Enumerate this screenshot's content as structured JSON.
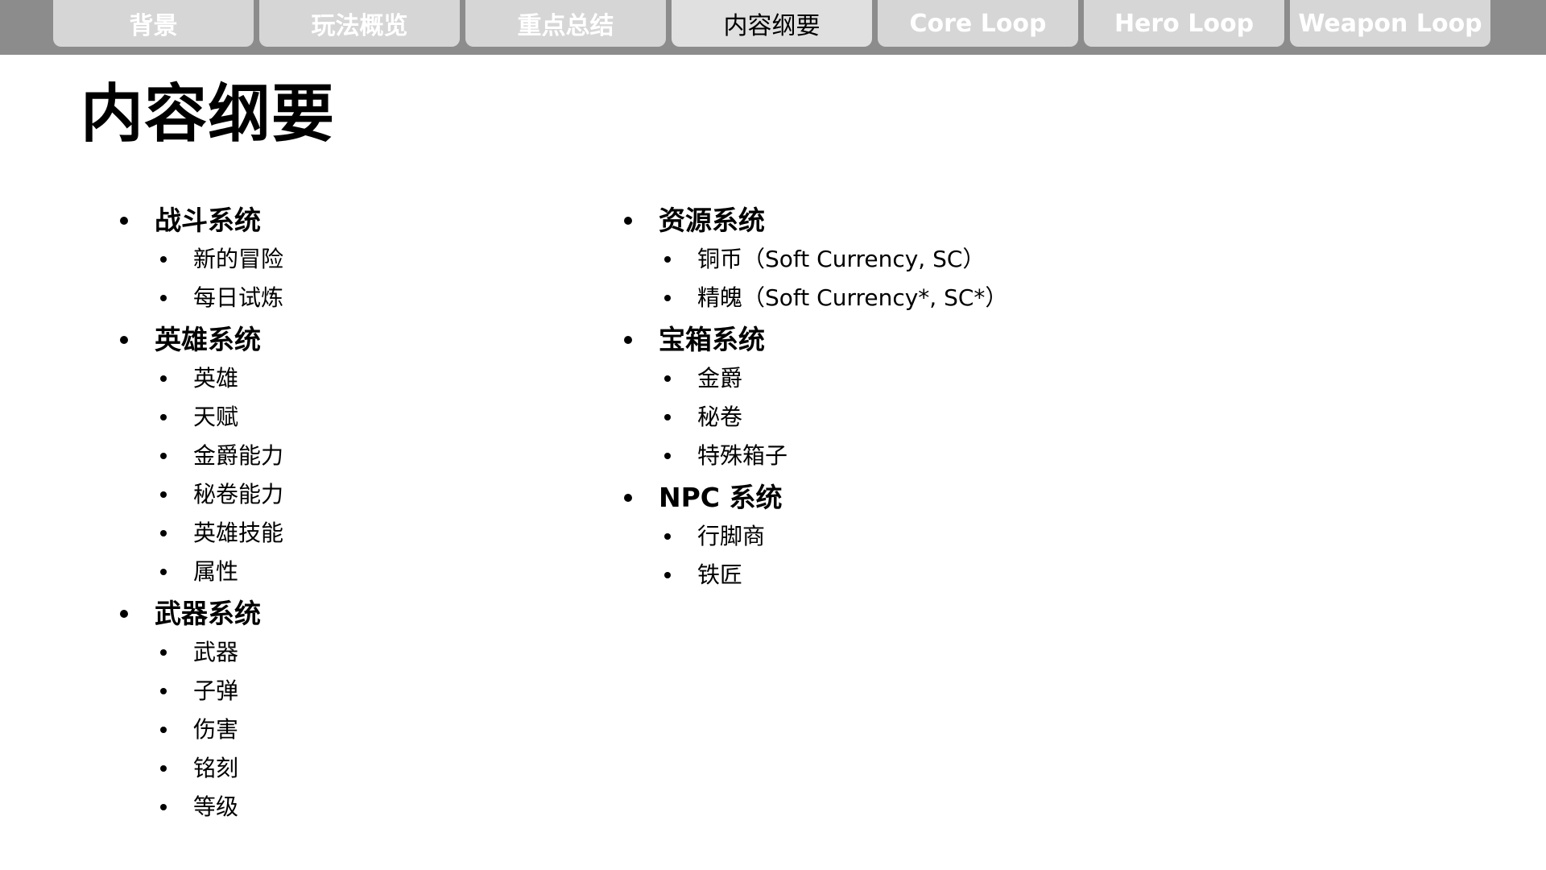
{
  "tabs": [
    {
      "label": "背景",
      "active": false
    },
    {
      "label": "玩法概览",
      "active": false
    },
    {
      "label": "重点总结",
      "active": false
    },
    {
      "label": "内容纲要",
      "active": true
    },
    {
      "label": "Core Loop",
      "active": false
    },
    {
      "label": "Hero Loop",
      "active": false
    },
    {
      "label": "Weapon Loop",
      "active": false
    }
  ],
  "page": {
    "title": "内容纲要"
  },
  "left_column": {
    "sections": [
      {
        "label": "战斗系统",
        "items": [
          "新的冒险",
          "每日试炼"
        ]
      },
      {
        "label": "英雄系统",
        "items": [
          "英雄",
          "天赋",
          "金爵能力",
          "秘卷能力",
          "英雄技能",
          "属性"
        ]
      },
      {
        "label": "武器系统",
        "items": [
          "武器",
          "子弹",
          "伤害",
          "铭刻",
          "等级"
        ]
      }
    ]
  },
  "right_column": {
    "sections": [
      {
        "label": "资源系统",
        "items": [
          "铜币（Soft Currency, SC）",
          "精魄（Soft Currency*, SC*）"
        ]
      },
      {
        "label": "宝箱系统",
        "items": [
          "金爵",
          "秘卷",
          "特殊箱子"
        ]
      },
      {
        "label": "NPC 系统",
        "items": [
          "行脚商",
          "铁匠"
        ]
      }
    ]
  },
  "colors": {
    "tabbar_bg": "#8c8c8c",
    "tab_bg": "#d6d6d6",
    "tab_active_bg": "#e0e0e0",
    "tab_text": "#ffffff",
    "tab_active_text": "#000000",
    "body_text": "#000000",
    "page_bg": "#ffffff"
  }
}
